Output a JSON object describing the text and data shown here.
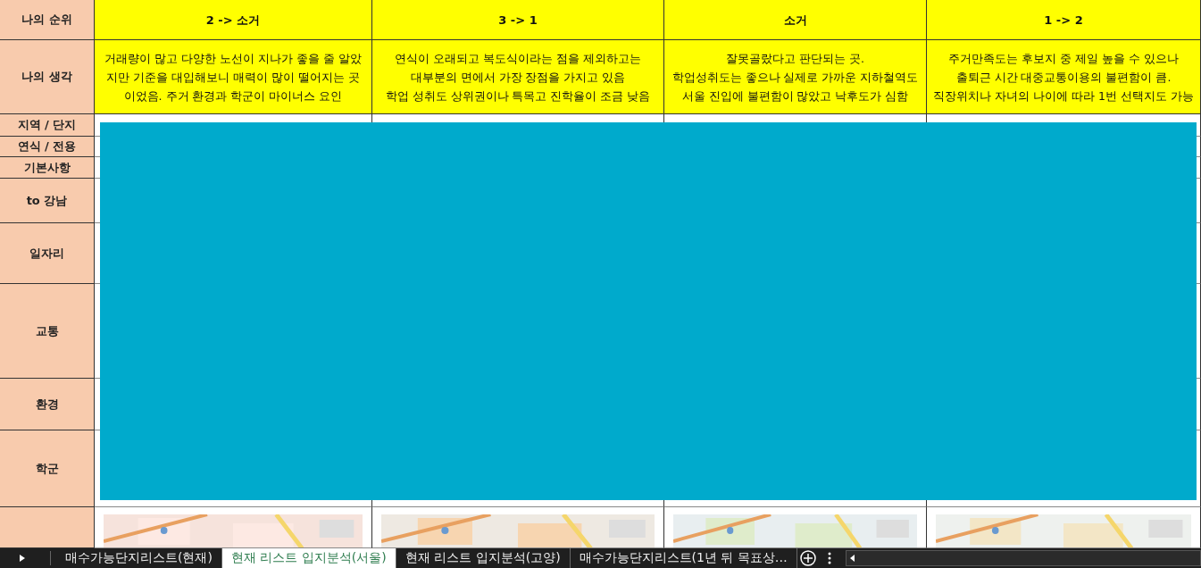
{
  "rows": [
    {
      "label": "나의 순위",
      "kind": "rank",
      "cells": [
        "2 -> 소거",
        "3 -> 1",
        "소거",
        "1 -> 2"
      ]
    },
    {
      "label": "나의 생각",
      "kind": "note",
      "cells": [
        "거래량이 많고 다양한 노선이 지나가 좋을 줄 알았\n지만 기준을 대입해보니 매력이 많이 떨어지는 곳\n이었음. 주거 환경과 학군이 마이너스 요인",
        "연식이 오래되고 복도식이라는 점을 제외하고는\n대부분의 면에서 가장 장점을 가지고 있음\n학업 성취도 상위권이나 특목고 진학율이 조금 낮음",
        "잘못골랐다고 판단되는 곳.\n학업성취도는 좋으나 실제로 가까운 지하철역도\n서울 진입에 불편함이 많았고 낙후도가 심함",
        "주거만족도는 후보지 중 제일 높을 수 있으나\n출퇴근 시간 대중교통이용의 불편함이 큼.\n직장위치나 자녀의 나이에 따라 1번 선택지도 가능"
      ]
    },
    {
      "label": "지역 / 단지",
      "kind": "plain"
    },
    {
      "label": "연식 / 전용",
      "kind": "plain"
    },
    {
      "label": "기본사항",
      "kind": "plain"
    },
    {
      "label": "to 강남",
      "kind": "plain"
    },
    {
      "label": "일자리",
      "kind": "plain"
    },
    {
      "label": "교통",
      "kind": "plain"
    },
    {
      "label": "환경",
      "kind": "plain"
    },
    {
      "label": "학군",
      "kind": "plain"
    },
    {
      "kind": "map"
    }
  ],
  "redaction": {
    "kind": "block"
  },
  "sheet_tabs": [
    {
      "label": "매수가능단지리스트(현재)",
      "selected": false
    },
    {
      "label": "현재 리스트 입지분석(서울)",
      "selected": true
    },
    {
      "label": "현재 리스트 입지분석(고양)",
      "selected": false
    },
    {
      "label": "매수가능단지리스트(1년 뒤 목표상…",
      "selected": false
    }
  ]
}
